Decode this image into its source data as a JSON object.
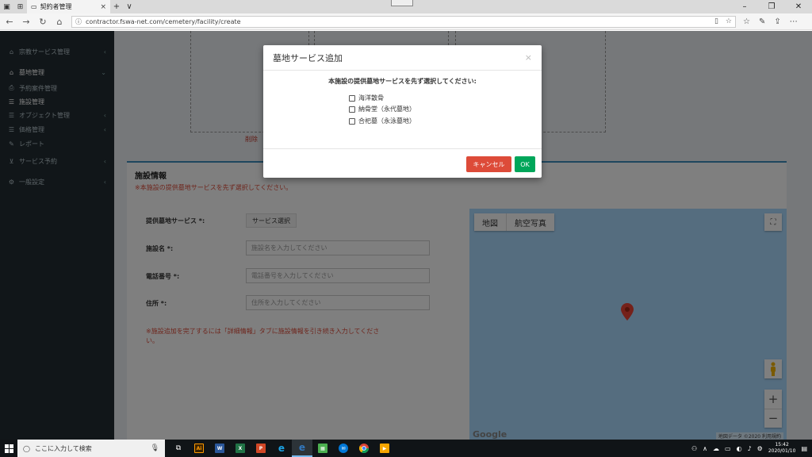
{
  "browser": {
    "tab_title": "契約者管理",
    "tab_close": "×",
    "tab_add": "+",
    "tab_more": "∨",
    "url": "contractor.fswa-net.com/cemetery/facility/create",
    "back": "←",
    "forward": "→",
    "refresh": "↻",
    "home": "⌂",
    "minimize": "–",
    "restore": "❐",
    "close": "✕"
  },
  "sidebar": {
    "items": [
      {
        "label": "宗教サービス管理",
        "icon": "home-icon"
      },
      {
        "label": "墓地管理",
        "icon": "home-icon"
      },
      {
        "label": "予約案件管理",
        "icon": "printer-icon"
      },
      {
        "label": "施設管理",
        "icon": "list-icon"
      },
      {
        "label": "オブジェクト管理",
        "icon": "list-icon"
      },
      {
        "label": "価格管理",
        "icon": "list-icon"
      },
      {
        "label": "レポート",
        "icon": "edit-icon"
      },
      {
        "label": "サービス予約",
        "icon": "cart-icon"
      },
      {
        "label": "一般設定",
        "icon": "gear-icon"
      }
    ]
  },
  "content": {
    "delete_link": "削除",
    "section_title": "施設情報",
    "section_warning": "※本施設の提供墓地サービスを先ず選択してください。",
    "form": {
      "service_label": "提供墓地サービス *:",
      "service_button": "サービス選択",
      "name_label": "施設名 *:",
      "name_placeholder": "施設名を入力してください",
      "phone_label": "電話番号 *:",
      "phone_placeholder": "電話番号を入力してください",
      "address_label": "住所 *:",
      "address_placeholder": "住所を入力してください",
      "note": "※施設追加を完了するには「詳細情報」タブに施設情報を引き続き入力してください。"
    },
    "map": {
      "tab_map": "地図",
      "tab_satellite": "航空写真",
      "zoom_in": "+",
      "zoom_out": "−",
      "google": "Google",
      "attribution": "地図データ ©2020  利用規約"
    }
  },
  "modal": {
    "title": "墓地サービス追加",
    "close": "×",
    "question": "本施設の提供墓地サービスを先ず選択してください:",
    "options": [
      "海洋散骨",
      "納骨堂（永代墓地）",
      "合祀墓（永泳墓地）"
    ],
    "cancel": "キャンセル",
    "ok": "OK"
  },
  "taskbar": {
    "search_placeholder": "ここに入力して検索",
    "time": "15:42",
    "date": "2020/01/10"
  },
  "colors": {
    "sidebar_bg": "#222d32",
    "primary_border": "#3c8dbc",
    "danger": "#dd4b39",
    "success": "#00a65a",
    "map_bg": "#aadaff"
  }
}
